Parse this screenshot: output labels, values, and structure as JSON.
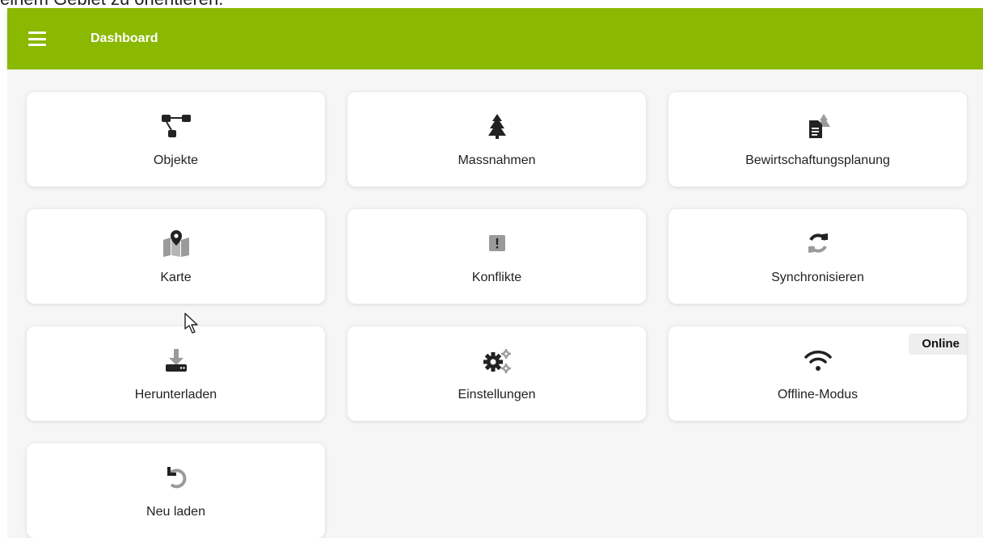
{
  "page": {
    "top_text": "einem Gebiet zu orientieren."
  },
  "appbar": {
    "title": "Dashboard",
    "color": "#8bb800"
  },
  "tiles": [
    {
      "label": "Objekte",
      "icon": "object-group-icon"
    },
    {
      "label": "Massnahmen",
      "icon": "tree-icon"
    },
    {
      "label": "Bewirtschaftungsplanung",
      "icon": "document-tree-icon"
    },
    {
      "label": "Karte",
      "icon": "map-pin-icon"
    },
    {
      "label": "Konflikte",
      "icon": "alert-square-icon"
    },
    {
      "label": "Synchronisieren",
      "icon": "sync-icon"
    },
    {
      "label": "Herunterladen",
      "icon": "download-icon"
    },
    {
      "label": "Einstellungen",
      "icon": "gears-icon"
    },
    {
      "label": "Offline-Modus",
      "icon": "wifi-icon",
      "badge": "Online"
    },
    {
      "label": "Neu laden",
      "icon": "reload-icon"
    }
  ]
}
